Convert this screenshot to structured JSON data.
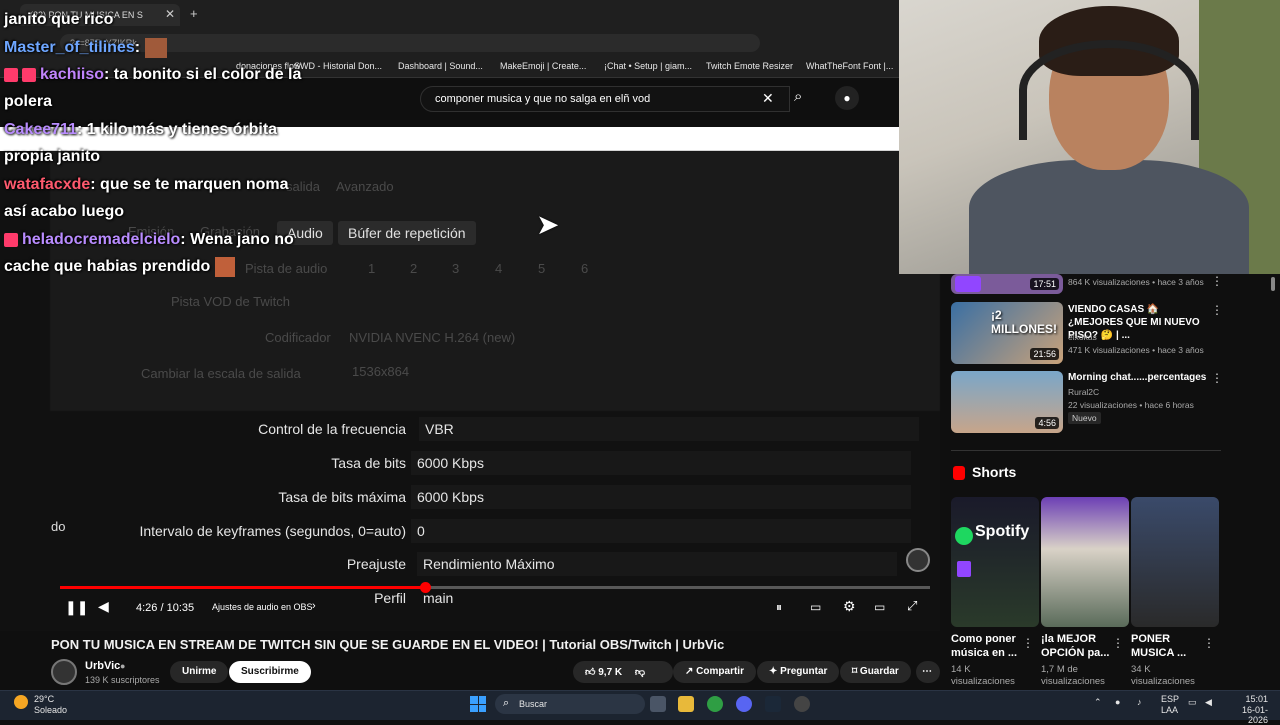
{
  "browser": {
    "tab_title": "(22) PON TU MUSICA EN S",
    "url": "?v=87E_YZIKRk",
    "bookmarks": [
      "donaciones flow",
      "SWD - Historial Don...",
      "Dashboard | Sound...",
      "MakeEmoji | Create...",
      "¡Chat • Setup | giam...",
      "Twitch Emote Resizer",
      "WhatTheFont Font |..."
    ]
  },
  "search": {
    "query": "componer musica y que no salga en elñ vod"
  },
  "chat": [
    {
      "user": "",
      "message": "janito que rico"
    },
    {
      "user": "Master_of_tilines",
      "message": ":"
    },
    {
      "user": "kachiiso",
      "message": ": ta bonito si el color de la polera"
    },
    {
      "user": "Cakee711",
      "message": ": 1 kilo más y tienes órbita propia janito"
    },
    {
      "user": "watafacxde",
      "message": ": que se te marquen noma así acabo luego"
    },
    {
      "user": "heladocremadelcielo",
      "message": ": Wena jano no cache que habias prendido"
    }
  ],
  "obs": {
    "faded_tabs": [
      "Emisión",
      "Grabación"
    ],
    "tabs": [
      "Audio",
      "Búfer de repetición"
    ],
    "faded_rows": [
      "salida",
      "Avanzado",
      "Pista de audio",
      "Pista VOD de Twitch",
      "Codificador",
      "NVIDIA NVENC H.264 (new)",
      "Cambiar la escala de salida",
      "1536x864"
    ],
    "track_numbers": [
      "1",
      "2",
      "3",
      "4",
      "5",
      "6"
    ],
    "settings": [
      {
        "label": "Control de la frecuencia",
        "value": "VBR"
      },
      {
        "label": "Tasa de bits",
        "value": "6000 Kbps"
      },
      {
        "label": "Tasa de bits máxima",
        "value": "6000 Kbps"
      },
      {
        "label": "Intervalo de keyframes (segundos, 0=auto)",
        "value": "0"
      },
      {
        "label": "Preajuste",
        "value": "Rendimiento Máximo"
      },
      {
        "label": "Perfil",
        "value": "main"
      }
    ],
    "side_text": "do"
  },
  "player": {
    "time": "4:26 / 10:35",
    "chapter": "Ajustes de audio en OBS",
    "progress_fraction": 0.42
  },
  "video": {
    "title": "PON TU MUSICA EN STREAM DE TWITCH SIN QUE SE GUARDE EN EL VIDEO! | Tutorial OBS/Twitch | UrbVic",
    "channel": "UrbVic",
    "subscribers": "139 K suscriptores",
    "join_label": "Unirme",
    "subscribe_label": "Suscribirme",
    "likes": "9,7 K",
    "share_label": "Compartir",
    "ask_label": "Preguntar",
    "save_label": "Guardar"
  },
  "recommendations": [
    {
      "title": "",
      "meta": "864 K visualizaciones • hace 3 años",
      "duration": "17:51"
    },
    {
      "title": "VIENDO CASAS 🏠 ¿MEJORES QUE MI NUEVO PISO? 🤔 | ...",
      "channel": "elxokas",
      "meta": "471 K visualizaciones • hace 3 años",
      "duration": "21:56",
      "thumb_text": "¡2 MILLONES!"
    },
    {
      "title": "Morning chat......percentages",
      "channel": "Rural2C",
      "meta": "22 visualizaciones • hace 6 horas",
      "badge": "Nuevo",
      "duration": "4:56"
    }
  ],
  "shorts": {
    "heading": "Shorts",
    "items": [
      {
        "title": "Como poner música en ...",
        "views": "14 K visualizaciones",
        "thumb_text": "Spotify"
      },
      {
        "title": "¡la MEJOR OPCIÓN pa...",
        "views": "1,7 M de visualizaciones"
      },
      {
        "title": "PONER MUSICA ...",
        "views": "34 K visualizaciones"
      }
    ]
  },
  "taskbar": {
    "weather_temp": "29°C",
    "weather_desc": "Soleado",
    "search_label": "Buscar",
    "lang": "ESP",
    "lang2": "LAA",
    "time": "15:01",
    "date": "16-01-2026"
  },
  "colors": {
    "accent": "#ff0000",
    "bg": "#0f0f0f"
  }
}
